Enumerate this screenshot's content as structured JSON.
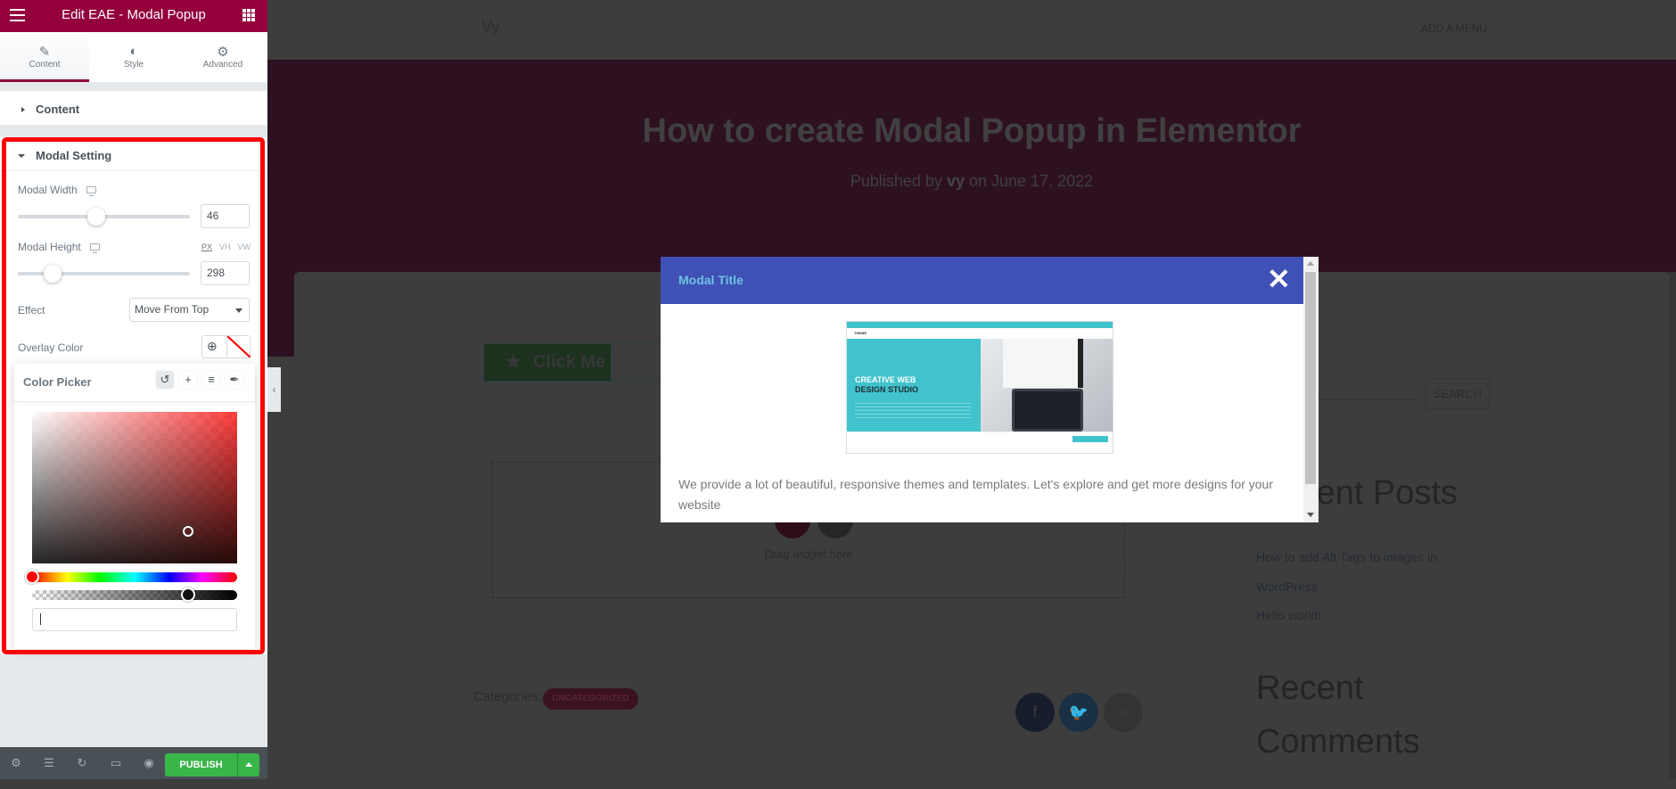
{
  "editor": {
    "title": "Edit EAE - Modal Popup",
    "tabs": [
      {
        "label": "Content",
        "icon": "pencil-icon",
        "active": true
      },
      {
        "label": "Style",
        "icon": "half-circle-icon",
        "active": false
      },
      {
        "label": "Advanced",
        "icon": "gear-icon",
        "active": false
      }
    ],
    "sections": {
      "content": {
        "title": "Content",
        "expanded": false
      },
      "modal_setting": {
        "title": "Modal Setting",
        "expanded": true
      }
    },
    "controls": {
      "modal_width": {
        "label": "Modal Width",
        "value": "46",
        "slider_fraction": 0.46
      },
      "modal_height": {
        "label": "Modal Height",
        "value": "298",
        "units": [
          "PX",
          "VH",
          "VW"
        ],
        "active_unit": "PX",
        "slider_fraction": 0.2
      },
      "effect": {
        "label": "Effect",
        "value": "Move From Top"
      },
      "overlay_color": {
        "label": "Overlay Color"
      }
    },
    "color_picker": {
      "title": "Color Picker",
      "buttons": [
        "reset-icon",
        "add-icon",
        "stack-icon",
        "eyedropper-icon"
      ],
      "hue_fraction": 0.0,
      "alpha_fraction": 0.76,
      "saturation_fraction": 0.77,
      "value_fraction": 0.2,
      "hex_value": ""
    },
    "footer": {
      "icons": [
        "settings-icon",
        "layers-icon",
        "history-icon",
        "responsive-icon",
        "preview-icon"
      ],
      "publish_label": "PUBLISH"
    },
    "colors": {
      "brand": "#93003c",
      "publish": "#39b54a",
      "highlight_frame": "#ff0000"
    }
  },
  "site": {
    "logo": "Vy",
    "menu": "ADD A MENU",
    "post_title": "How to create Modal Popup in Elementor",
    "meta": {
      "prefix": "Published by",
      "author": "vy",
      "suffix": "on June 17, 2022"
    },
    "button_label": "Click Me",
    "drag_text": "Drag widget here",
    "categories_label": "Categories:",
    "category": "UNCATEGORIZED",
    "social": [
      "facebook-icon",
      "twitter-icon",
      "email-icon"
    ],
    "search_button": "SEARCH",
    "recent_posts_title": "Recent Posts",
    "recent_posts": [
      "How to add Alt Tags to images in WordPress",
      "Hello world!"
    ],
    "recent_comments_title": "Recent Comments"
  },
  "modal": {
    "title": "Modal Title",
    "close": "✕",
    "image_heading_1": "CREATIVE WEB",
    "image_heading_2": "DESIGN STUDIO",
    "image_logo": "THEME",
    "text": "We provide a lot of beautiful, responsive themes and templates. Let's explore and get more designs for your website",
    "colors": {
      "header": "#3f51b5",
      "title": "#6ec1e4"
    }
  }
}
